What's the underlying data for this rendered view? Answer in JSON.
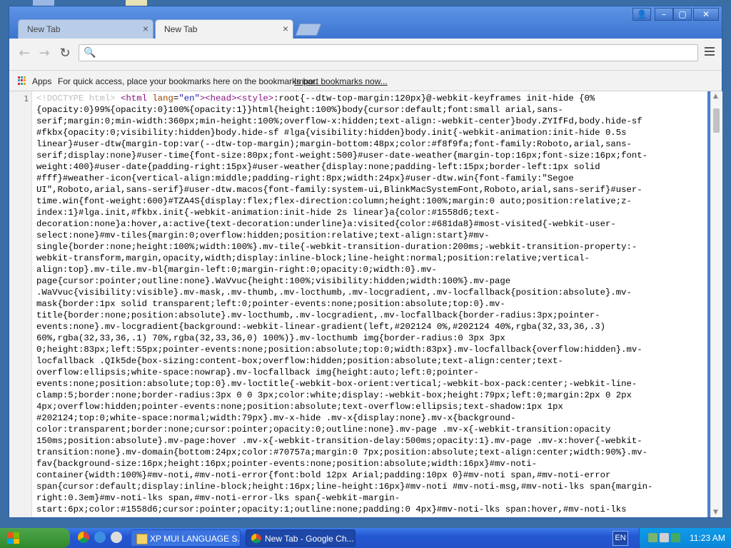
{
  "browser": {
    "tabs": [
      {
        "label": "New Tab",
        "active": false
      },
      {
        "label": "New Tab",
        "active": true
      }
    ],
    "tab_close_glyph": "×",
    "window_buttons": [
      "user-icon",
      "minimize-icon",
      "maximize-icon",
      "close-icon"
    ],
    "omnibox": {
      "value": "",
      "placeholder": ""
    },
    "bookmarks_bar": {
      "apps_label": "Apps",
      "hint": "For quick access, place your bookmarks here on the bookmarks bar.",
      "import_link": "Import bookmarks now..."
    }
  },
  "source_view": {
    "line_number": "1",
    "lines": [
      "{opacity:0}99%{opacity:0}100%{opacity:1}}html{height:100%}body{cursor:default;font:small arial,sans-",
      "serif;margin:0;min-width:360px;min-height:100%;overflow-x:hidden;text-align:-webkit-center}body.ZYIfFd,body.hide-sf",
      "#fkbx{opacity:0;visibility:hidden}body.hide-sf #lga{visibility:hidden}body.init{-webkit-animation:init-hide 0.5s",
      "linear}#user-dtw{margin-top:var(--dtw-top-margin);margin-bottom:48px;color:#f8f9fa;font-family:Roboto,arial,sans-",
      "serif;display:none}#user-time{font-size:80px;font-weight:500}#user-date-weather{margin-top:16px;font-size:16px;font-",
      "weight:400}#user-date{padding-right:15px}#user-weather{display:none;padding-left:15px;border-left:1px solid",
      "#fff}#weather-icon{vertical-align:middle;padding-right:8px;width:24px}#user-dtw.win{font-family:\"Segoe",
      "UI\",Roboto,arial,sans-serif}#user-dtw.macos{font-family:system-ui,BlinkMacSystemFont,Roboto,arial,sans-serif}#user-",
      "time.win{font-weight:600}#TZA4S{display:flex;flex-direction:column;height:100%;margin:0 auto;position:relative;z-",
      "index:1}#lga.init,#fkbx.init{-webkit-animation:init-hide 2s linear}a{color:#1558d6;text-",
      "decoration:none}a:hover,a:active{text-decoration:underline}a:visited{color:#681da8}#most-visited{-webkit-user-",
      "select:none}#mv-tiles{margin:0;overflow:hidden;position:relative;text-align:start}#mv-",
      "single{border:none;height:100%;width:100%}.mv-tile{-webkit-transition-duration:200ms;-webkit-transition-property:-",
      "webkit-transform,margin,opacity,width;display:inline-block;line-height:normal;position:relative;vertical-",
      "align:top}.mv-tile.mv-bl{margin-left:0;margin-right:0;opacity:0;width:0}.mv-",
      "page{cursor:pointer;outline:none}.WaVvuc{height:100%;visibility:hidden;width:100%}.mv-page",
      ".WaVvuc{visibility:visible}.mv-mask,.mv-thumb,.mv-locthumb,.mv-locgradient,.mv-locfallback{position:absolute}.mv-",
      "mask{border:1px solid transparent;left:0;pointer-events:none;position:absolute;top:0}.mv-",
      "title{border:none;position:absolute}.mv-locthumb,.mv-locgradient,.mv-locfallback{border-radius:3px;pointer-",
      "events:none}.mv-locgradient{background:-webkit-linear-gradient(left,#202124 0%,#202124 40%,rgba(32,33,36,.3)",
      "60%,rgba(32,33,36,.1) 70%,rgba(32,33,36,0) 100%)}.mv-locthumb img{border-radius:0 3px 3px",
      "0;height:83px;left:55px;pointer-events:none;position:absolute;top:0;width:83px}.mv-locfallback{overflow:hidden}.mv-",
      "locfallback .QIk5de{box-sizing:content-box;overflow:hidden;position:absolute;text-align:center;text-",
      "overflow:ellipsis;white-space:nowrap}.mv-locfallback img{height:auto;left:0;pointer-",
      "events:none;position:absolute;top:0}.mv-loctitle{-webkit-box-orient:vertical;-webkit-box-pack:center;-webkit-line-",
      "clamp:5;border:none;border-radius:3px 0 0 3px;color:white;display:-webkit-box;height:79px;left:0;margin:2px 0 2px",
      "4px;overflow:hidden;pointer-events:none;position:absolute;text-overflow:ellipsis;text-shadow:1px 1px",
      "#202124;top:0;white-space:normal;width:79px}.mv-x-hide .mv-x{display:none}.mv-x{background-",
      "color:transparent;border:none;cursor:pointer;opacity:0;outline:none}.mv-page .mv-x{-webkit-transition:opacity",
      "150ms;position:absolute}.mv-page:hover .mv-x{-webkit-transition-delay:500ms;opacity:1}.mv-page .mv-x:hover{-webkit-",
      "transition:none}.mv-domain{bottom:24px;color:#70757a;margin:0 7px;position:absolute;text-align:center;width:90%}.mv-",
      "fav{background-size:16px;height:16px;pointer-events:none;position:absolute;width:16px}#mv-noti-",
      "container{width:100%}#mv-noti,#mv-noti-error{font:bold 12px Arial;padding:10px 0}#mv-noti span,#mv-noti-error",
      "span{cursor:default;display:inline-block;height:16px;line-height:16px}#mv-noti #mv-noti-msg,#mv-noti-lks span{margin-",
      "right:0.3em}#mv-noti-lks span,#mv-noti-error-lks span{-webkit-margin-",
      "start:6px;color:#1558d6;cursor:pointer;opacity:1;outline:none;padding:0 4px}#mv-noti-lks span:hover,#mv-noti-lks"
    ],
    "first_line": {
      "doctype": "<!DOCTYPE html>",
      "html_open": "<html",
      "lang_attr": "lang",
      "lang_val": "\"en\"",
      "head_tags": "><head><style>",
      "rest": ":root{--dtw-top-margin:120px}@-webkit-keyframes init-hide {0%"
    }
  },
  "taskbar": {
    "start_icon": "windows-logo-icon",
    "quick_launch": [
      "chrome-icon",
      "ie-icon",
      "media-player-icon"
    ],
    "tasks": [
      {
        "label": "XP MUI LANGUAGE S...",
        "icon": "folder-icon"
      },
      {
        "label": "New Tab - Google Ch...",
        "icon": "chrome-icon"
      }
    ],
    "language": "EN",
    "clock": "11:23 AM"
  },
  "colors": {
    "tag": "#881280",
    "doctype": "#c0c0c0",
    "taskbar": "#2458d3",
    "start": "#3a9a36"
  }
}
